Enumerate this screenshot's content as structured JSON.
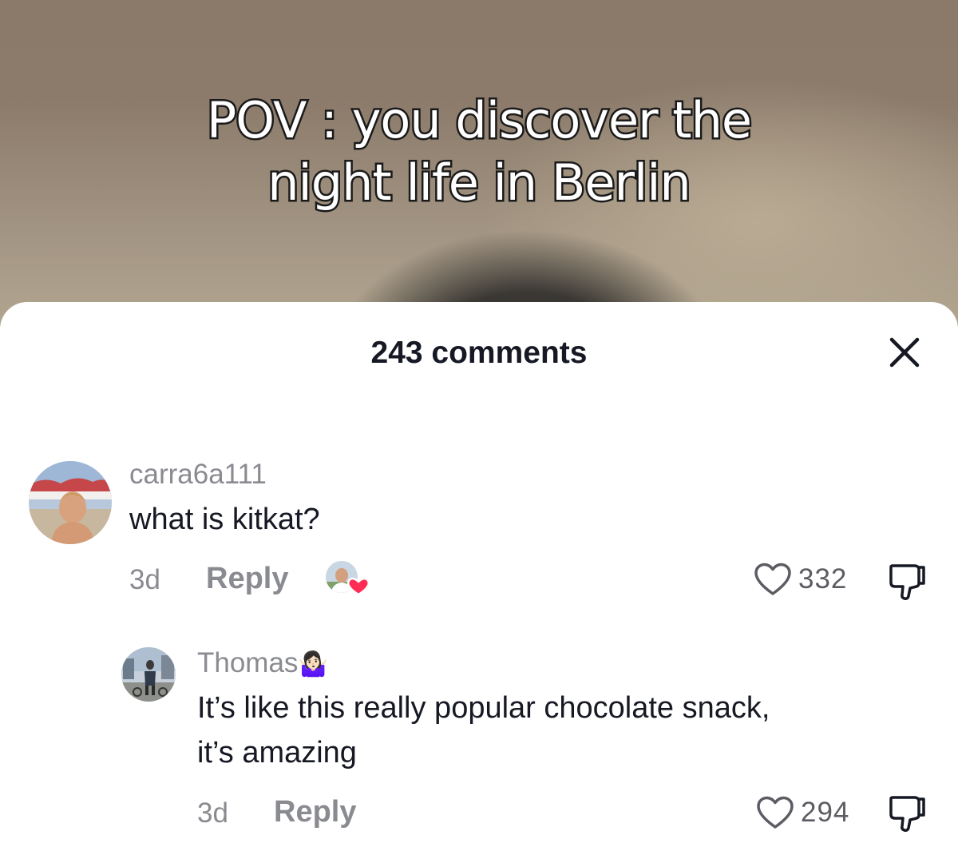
{
  "video": {
    "caption_line1": "POV : you discover the",
    "caption_line2": "night life in Berlin"
  },
  "sheet": {
    "title": "243 comments",
    "close_icon": "close-icon"
  },
  "comments": [
    {
      "username": "carra6a111",
      "text_lines": [
        "what is kitkat?"
      ],
      "age": "3d",
      "reply_label": "Reply",
      "likes": "332",
      "creator_liked": true
    },
    {
      "username": "Thomas",
      "username_emoji": "🤷🏻‍♀️",
      "text_lines": [
        "It’s like this really popular chocolate snack,",
        "it’s amazing"
      ],
      "age": "3d",
      "reply_label": "Reply",
      "likes": "294"
    }
  ],
  "colors": {
    "text_primary": "#161823",
    "text_secondary": "#8a8b91",
    "heart_red": "#fe2c55"
  }
}
